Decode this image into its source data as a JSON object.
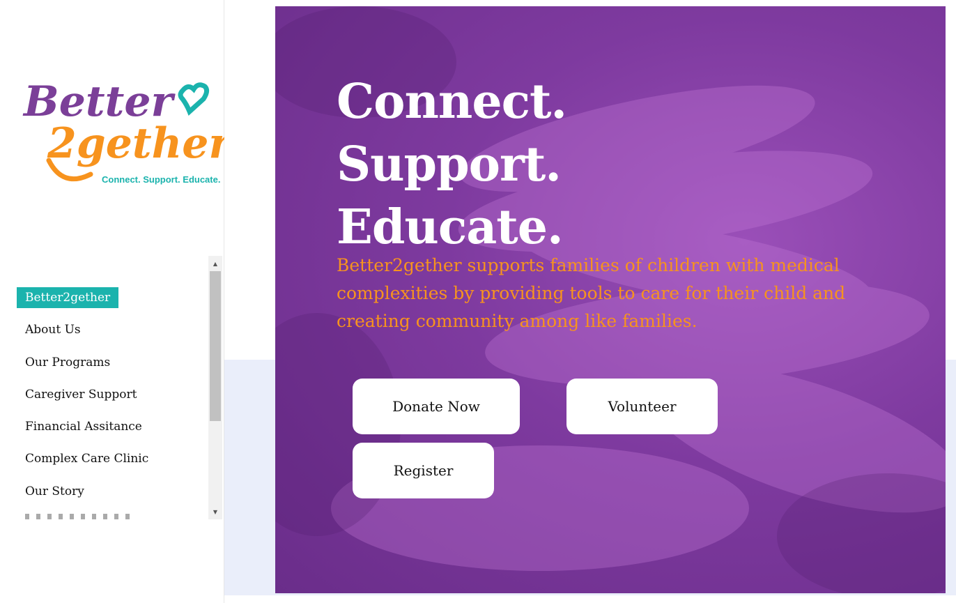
{
  "brand": {
    "logo_line1": "Better",
    "logo_line2": "2gether",
    "tagline": "Connect. Support. Educate.",
    "colors": {
      "purple": "#7b3f98",
      "orange": "#f7931e",
      "teal": "#1bb3ad"
    }
  },
  "sidebar": {
    "items": [
      {
        "label": "Better2gether",
        "active": true
      },
      {
        "label": "About Us"
      },
      {
        "label": "Our Programs"
      },
      {
        "label": "Caregiver Support"
      },
      {
        "label": "Financial Assitance"
      },
      {
        "label": "Complex Care Clinic"
      },
      {
        "label": "Our Story"
      }
    ],
    "scrollbar": {
      "up_icon": "triangle-up",
      "down_icon": "triangle-down"
    }
  },
  "hero": {
    "headline": [
      "Connect.",
      "Support.",
      "Educate."
    ],
    "description": "Better2gether supports families of children with medical complexities by providing tools to care for their child and creating community among like families.",
    "buttons": {
      "donate": "Donate Now",
      "volunteer": "Volunteer",
      "register": "Register"
    }
  }
}
